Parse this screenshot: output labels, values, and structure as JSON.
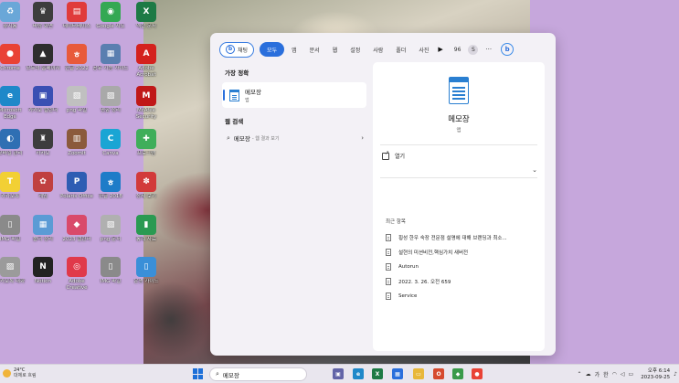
{
  "desktop": {
    "icons": [
      {
        "label": "휴지통",
        "color": "#6aa7d8",
        "glyph": "♻"
      },
      {
        "label": "바탕 화면",
        "color": "#3d3d3d",
        "glyph": "♛"
      },
      {
        "label": "데이터베이스",
        "color": "#e03b3b",
        "glyph": "▤"
      },
      {
        "label": "Google 지도",
        "color": "#34a853",
        "glyph": "◉"
      },
      {
        "label": "엑셀 문서",
        "color": "#1d7a45",
        "glyph": "X"
      },
      {
        "label": "Chrome",
        "color": "#e94235",
        "glyph": "●"
      },
      {
        "label": "모두의 홈페이지",
        "color": "#2e2e2e",
        "glyph": "▲"
      },
      {
        "label": "한글 2022",
        "color": "#e85a3a",
        "glyph": "ㅎ"
      },
      {
        "label": "공유 기능 가이드",
        "color": "#5a7fb0",
        "glyph": "▦"
      },
      {
        "label": "Adobe Acrobat",
        "color": "#d4221e",
        "glyph": "A"
      },
      {
        "label": "Microsoft Edge",
        "color": "#1e88c9",
        "glyph": "e"
      },
      {
        "label": "카카오 캘린더",
        "color": "#3a4fb3",
        "glyph": "▣"
      },
      {
        "label": "png 파일",
        "color": "#c0c0c0",
        "glyph": "▧"
      },
      {
        "label": "명함 정리",
        "color": "#a9a9a9",
        "glyph": "▨"
      },
      {
        "label": "McAfee Security",
        "color": "#c01818",
        "glyph": "M"
      },
      {
        "label": "모바일 관리",
        "color": "#2f6fb3",
        "glyph": "◐"
      },
      {
        "label": "카카오",
        "color": "#3d3d3d",
        "glyph": "♜"
      },
      {
        "label": "ZoomIt",
        "color": "#8b5a3c",
        "glyph": "▥"
      },
      {
        "label": "Canva",
        "color": "#1aa5d4",
        "glyph": "C"
      },
      {
        "label": "프로그램",
        "color": "#3fae5a",
        "glyph": "✚"
      },
      {
        "label": "카카오톡",
        "color": "#f2d034",
        "glyph": "T"
      },
      {
        "label": "게임",
        "color": "#c04040",
        "glyph": "✿"
      },
      {
        "label": "Polaris Office",
        "color": "#2e5db3",
        "glyph": "P"
      },
      {
        "label": "한글 2018",
        "color": "#1e7cc8",
        "glyph": "ㅎ"
      },
      {
        "label": "상세 보기",
        "color": "#d23a3a",
        "glyph": "✽"
      },
      {
        "label": "IMG 파일",
        "color": "#8a8a8a",
        "glyph": "▯"
      },
      {
        "label": "폴더 정리",
        "color": "#5b9bd5",
        "glyph": "▦"
      },
      {
        "label": "2023 캘린더",
        "color": "#d94a6a",
        "glyph": "◆"
      },
      {
        "label": "png 문서",
        "color": "#b0b0b0",
        "glyph": "▧"
      },
      {
        "label": "통계 자료",
        "color": "#2a9a52",
        "glyph": "▮"
      },
      {
        "label": "카카오톡 대화",
        "color": "#9b9b9b",
        "glyph": "▨"
      },
      {
        "label": "Notion",
        "color": "#222222",
        "glyph": "N"
      },
      {
        "label": "Adobe Creative",
        "color": "#e0394a",
        "glyph": "◎"
      },
      {
        "label": "IMG 파일",
        "color": "#8a8a8a",
        "glyph": "▯"
      },
      {
        "label": "운영 가이드",
        "color": "#3a8fd8",
        "glyph": "▯"
      }
    ]
  },
  "search_panel": {
    "filters": {
      "chat": "채팅",
      "all": "모두",
      "tabs": [
        "앱",
        "문서",
        "웹",
        "설정",
        "사람",
        "폴더",
        "사진"
      ],
      "points": "96",
      "avatar": "S",
      "more": "···",
      "bing": "b"
    },
    "best_match": {
      "section": "가장 정확",
      "title": "메모장",
      "subtitle": "앱"
    },
    "web_search": {
      "section": "웹 검색",
      "query": "메모장",
      "suffix": "- 웹 결과 보기"
    },
    "preview": {
      "title": "메모장",
      "subtitle": "앱",
      "open_label": "열기",
      "recent_title": "최근 항목",
      "recent_items": [
        "횡성 한우 숙장 전문점 설명에 대해 브랜딩과 최소...",
        "설현의 미션비전,핵심가치 새버전",
        "Autorun",
        "2022. 3. 26. 오전 659",
        "Service"
      ]
    }
  },
  "taskbar": {
    "weather_temp": "24°C",
    "weather_desc": "대체로 흐림",
    "search_value": "메모장",
    "ime_1": "가",
    "ime_2": "한",
    "time": "오후 6:14",
    "date": "2023-09-25",
    "apps": [
      {
        "name": "chat",
        "color": "#6264a7",
        "glyph": "▣"
      },
      {
        "name": "edge",
        "color": "#1e88c9",
        "glyph": "e"
      },
      {
        "name": "excel",
        "color": "#1d7a45",
        "glyph": "X"
      },
      {
        "name": "store",
        "color": "#2a6fdc",
        "glyph": "▦"
      },
      {
        "name": "explorer",
        "color": "#e8b73a",
        "glyph": "▭"
      },
      {
        "name": "office",
        "color": "#d64a2e",
        "glyph": "O"
      },
      {
        "name": "security",
        "color": "#3a9a4a",
        "glyph": "◆"
      },
      {
        "name": "chrome",
        "color": "#e94235",
        "glyph": "●"
      }
    ]
  }
}
